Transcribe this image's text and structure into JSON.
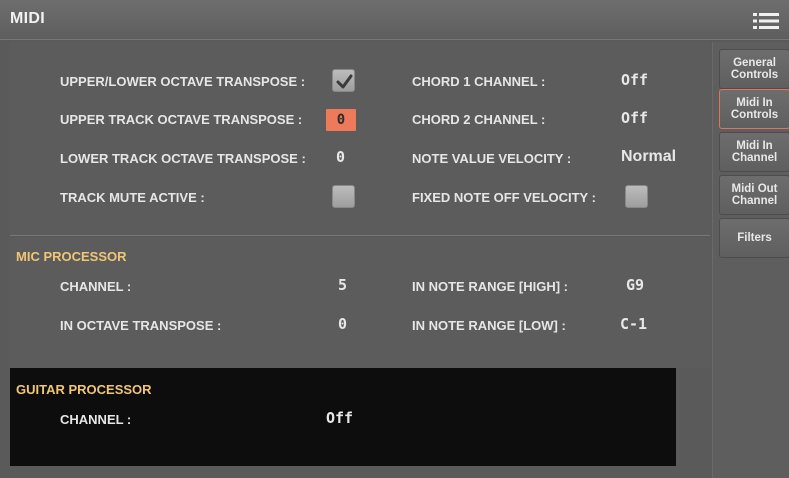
{
  "header": {
    "title": "MIDI"
  },
  "icons": {
    "menu": "menu-icon",
    "check": "checkmark-icon"
  },
  "colors": {
    "accent": "#ee7a5c",
    "section_title": "#f0c675",
    "active_tab_border": "#e2735a"
  },
  "midi_in_controls": {
    "upper_lower_octave_transpose": {
      "label": "UPPER/LOWER OCTAVE TRANSPOSE :",
      "checked": true
    },
    "upper_track_octave_transpose": {
      "label": "UPPER TRACK OCTAVE TRANSPOSE :",
      "value": "0"
    },
    "lower_track_octave_transpose": {
      "label": "LOWER TRACK OCTAVE TRANSPOSE :",
      "value": "0"
    },
    "track_mute_active": {
      "label": "TRACK MUTE ACTIVE :",
      "checked": false
    },
    "chord_1_channel": {
      "label": "CHORD 1 CHANNEL :",
      "value": "Off"
    },
    "chord_2_channel": {
      "label": "CHORD 2 CHANNEL :",
      "value": "Off"
    },
    "note_value_velocity": {
      "label": "NOTE VALUE VELOCITY :",
      "value": "Normal"
    },
    "fixed_note_off_velocity": {
      "label": "FIXED NOTE OFF VELOCITY :",
      "checked": false
    }
  },
  "mic_processor": {
    "title": "MIC PROCESSOR",
    "channel": {
      "label": "CHANNEL :",
      "value": "5"
    },
    "in_octave_transpose": {
      "label": "IN OCTAVE TRANSPOSE :",
      "value": "0"
    },
    "in_note_range_high": {
      "label": "IN NOTE RANGE [HIGH] :",
      "value": "G9"
    },
    "in_note_range_low": {
      "label": "IN NOTE RANGE [LOW] :",
      "value": "C-1"
    }
  },
  "guitar_processor": {
    "title": "GUITAR PROCESSOR",
    "channel": {
      "label": "CHANNEL :",
      "value": "Off"
    }
  },
  "sidebar": {
    "tabs": [
      {
        "line1": "General",
        "line2": "Controls",
        "active": false
      },
      {
        "line1": "Midi In",
        "line2": "Controls",
        "active": true
      },
      {
        "line1": "Midi In",
        "line2": "Channel",
        "active": false
      },
      {
        "line1": "Midi Out",
        "line2": "Channel",
        "active": false
      },
      {
        "line1": "Filters",
        "line2": "",
        "active": false
      }
    ]
  }
}
